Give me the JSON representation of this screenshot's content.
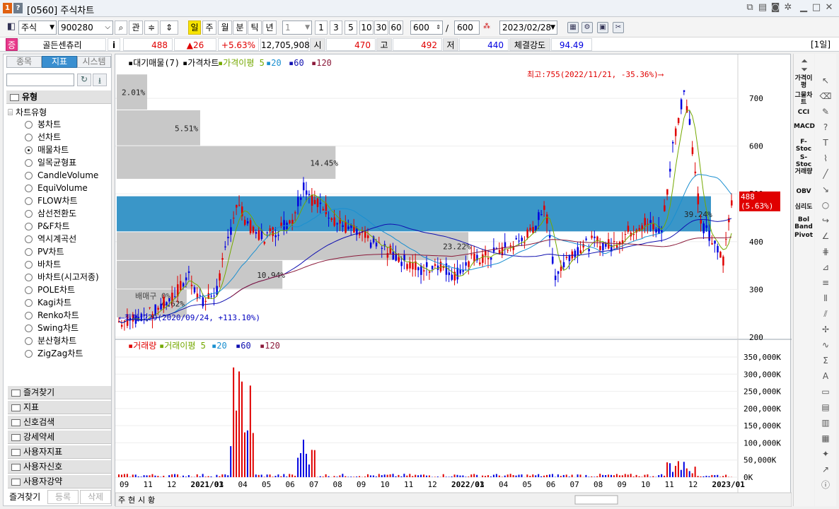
{
  "window": {
    "code": "[0560]",
    "title": "주식차트"
  },
  "toolbar": {
    "market": "주식",
    "code": "900280",
    "btn_gwan": "관",
    "periods": [
      "일",
      "주",
      "월",
      "분",
      "틱",
      "년"
    ],
    "interval_value": "1",
    "intervals": [
      "1",
      "3",
      "5",
      "10",
      "30",
      "60"
    ],
    "count_value": "600",
    "count_slash": "/",
    "count_total": "600",
    "date": "2023/02/28"
  },
  "quote": {
    "badge": "증",
    "name": "골든센츄리",
    "info": "i",
    "price": "488",
    "change": "▲26",
    "change_pct": "+5.63%",
    "volume": "12,705,908",
    "open_label": "시",
    "open": "470",
    "high_label": "고",
    "high": "492",
    "low_label": "저",
    "low": "440",
    "strength_label": "체결강도",
    "strength": "94.49",
    "period_tag": "[1일]"
  },
  "sidebar": {
    "tabs": [
      "종목",
      "지표",
      "시스템"
    ],
    "search_value": "",
    "section_title": "유형",
    "subtitle": "차트유형",
    "types": [
      "봉차트",
      "선차트",
      "매물차트",
      "일목균형표",
      "CandleVolume",
      "EquiVolume",
      "FLOW차트",
      "삼선전환도",
      "P&F차트",
      "역시계곡선",
      "PV차트",
      "바차트",
      "바차트(시고저종)",
      "POLE차트",
      "Kagi차트",
      "Renko차트",
      "Swing차트",
      "분산형차트",
      "ZigZag차트"
    ],
    "selected": "매물차트",
    "groups": [
      "즐겨찾기",
      "지표",
      "신호검색",
      "강세약세",
      "사용자지표",
      "사용자신호",
      "사용자강약"
    ],
    "footer": [
      "즐겨찾기",
      "등록",
      "삭제"
    ]
  },
  "chart": {
    "price_legend": [
      "대기매물(7)",
      "가격차트",
      "가격이평 5",
      "20",
      "60",
      "120"
    ],
    "volume_legend": [
      "거래량",
      "거래이평 5",
      "20",
      "60",
      "120"
    ],
    "high_note": "최고:755(2022/11/21, -35.36%)⟶",
    "low_note": "⟵최저:229(2020/09/24, +113.10%)",
    "price_ticks": [
      "700",
      "600",
      "500",
      "400",
      "300",
      "200"
    ],
    "volume_ticks": [
      "350,000K",
      "300,000K",
      "250,000K",
      "200,000K",
      "150,000K",
      "100,000K",
      "50,000K",
      "0K"
    ],
    "x_ticks": [
      "09",
      "11",
      "12",
      "2021/01",
      "03",
      "04",
      "05",
      "06",
      "07",
      "08",
      "09",
      "10",
      "11",
      "12",
      "2022/01",
      "03",
      "04",
      "05",
      "06",
      "07",
      "08",
      "09",
      "10",
      "11",
      "12",
      "2023/01"
    ],
    "last_price": "488",
    "last_pct": "(5.63%)",
    "ma_colors": {
      "ma5": "#74a800",
      "ma20": "#1a8fd0",
      "ma60": "#1010b0",
      "ma120": "#8b1a3a"
    },
    "up_color": "#e00000",
    "down_color": "#0000e0",
    "bottom_tabs": [
      "주",
      "현",
      "시",
      "황"
    ]
  },
  "chart_data": {
    "type": "bar",
    "title": "",
    "price_labels": [
      "2.01%",
      "5.51%",
      "14.45%",
      "39.24%",
      "23.22%",
      "10.94%",
      "4.62%",
      "배매구 0%"
    ],
    "volume_profile": [
      {
        "range": [
          675,
          750
        ],
        "pct": 2.01
      },
      {
        "range": [
          600,
          675
        ],
        "pct": 5.51
      },
      {
        "range": [
          530,
          600
        ],
        "pct": 14.45
      },
      {
        "range": [
          420,
          495
        ],
        "pct": 39.24
      },
      {
        "range": [
          360,
          420
        ],
        "pct": 23.22
      },
      {
        "range": [
          300,
          360
        ],
        "pct": 10.94
      },
      {
        "range": [
          240,
          300
        ],
        "pct": 4.62
      }
    ],
    "price_axis": [
      200,
      780
    ],
    "volume_axis": [
      0,
      350000
    ],
    "high": {
      "value": 755,
      "date": "2022/11/21"
    },
    "low": {
      "value": 229,
      "date": "2020/09/24"
    },
    "last": 488
  },
  "right_tools": [
    "가격이평",
    "그물차트",
    "CCI",
    "MACD",
    "F-Stoc",
    "S-Stoc",
    "거래량",
    "OBV",
    "심리도",
    "Bol Band",
    "Pivot"
  ]
}
